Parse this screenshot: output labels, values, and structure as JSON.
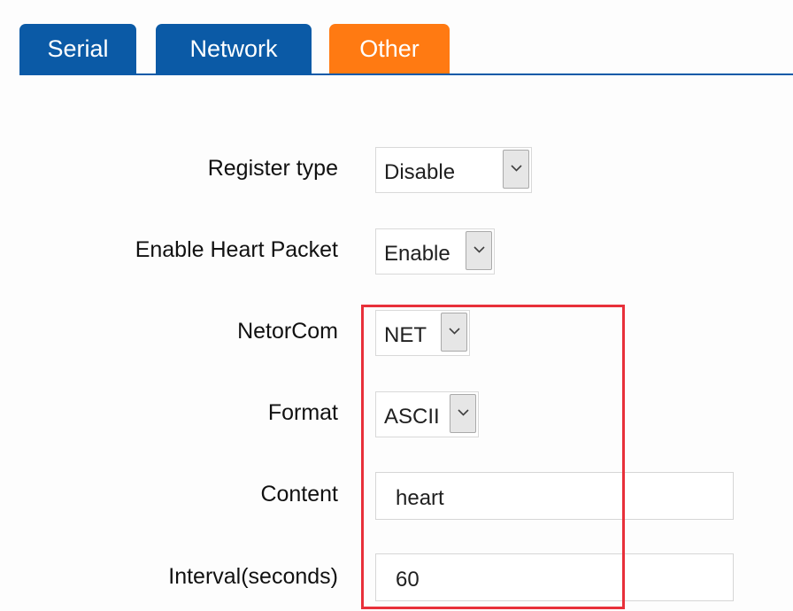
{
  "tabs": {
    "serial": "Serial",
    "network": "Network",
    "other": "Other"
  },
  "form": {
    "register_type": {
      "label": "Register type",
      "value": "Disable"
    },
    "enable_heart_packet": {
      "label": "Enable Heart Packet",
      "value": "Enable"
    },
    "netorcom": {
      "label": "NetorCom",
      "value": "NET"
    },
    "format": {
      "label": "Format",
      "value": "ASCII"
    },
    "content": {
      "label": "Content",
      "value": "heart"
    },
    "interval": {
      "label": "Interval(seconds)",
      "value": "60"
    }
  },
  "colors": {
    "tab_blue": "#0b5aa6",
    "tab_active_orange": "#ff7a12",
    "highlight_red": "#e8303a"
  },
  "icons": {
    "dropdown": "chevron-down-icon"
  }
}
